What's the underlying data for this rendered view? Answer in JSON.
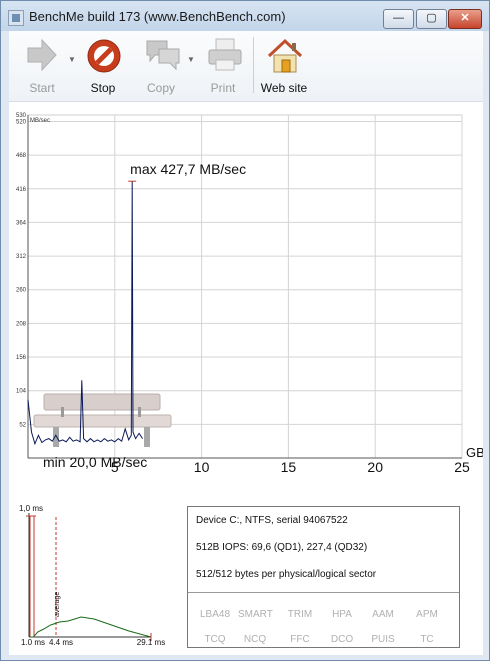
{
  "window": {
    "title": "BenchMe build 173 (www.BenchBench.com)"
  },
  "controls": {
    "minimize": "—",
    "maximize": "▢",
    "close": "✕"
  },
  "toolbar": {
    "buttons": [
      {
        "label": "Start",
        "icon": "arrow-right-icon",
        "enabled": false,
        "dropdown": true
      },
      {
        "label": "Stop",
        "icon": "stop-icon",
        "enabled": true,
        "dropdown": false
      },
      {
        "label": "Copy",
        "icon": "speech-bubbles-icon",
        "enabled": false,
        "dropdown": true
      },
      {
        "label": "Print",
        "icon": "printer-icon",
        "enabled": false,
        "dropdown": false
      },
      {
        "label": "Web site",
        "icon": "house-icon",
        "enabled": true,
        "dropdown": false
      }
    ]
  },
  "chart_data": [
    {
      "type": "line",
      "title": "",
      "ylabel": "MB/sec",
      "xlabel": "GB",
      "xlim": [
        0,
        25
      ],
      "ylim": [
        0,
        530
      ],
      "x_ticks": [
        5,
        10,
        15,
        20,
        25
      ],
      "y_ticks": [
        52,
        104,
        156,
        208,
        260,
        312,
        364,
        416,
        468,
        520
      ],
      "grid": true,
      "annotations": [
        "max 427,7 MB/sec",
        "min 20,0 MB/sec"
      ],
      "max": {
        "x": 6.0,
        "y": 427.7
      },
      "min": {
        "y": 20.0
      },
      "series": [
        {
          "color": "#0b1a5a",
          "x": [
            0.0,
            0.2,
            0.4,
            0.6,
            0.8,
            1.0,
            1.2,
            1.4,
            1.6,
            1.8,
            2.0,
            2.2,
            2.4,
            2.6,
            2.8,
            3.0,
            3.1,
            3.2,
            3.4,
            3.6,
            3.8,
            4.0,
            4.2,
            4.4,
            4.6,
            4.8,
            5.0,
            5.2,
            5.4,
            5.6,
            5.8,
            5.95,
            6.0,
            6.05,
            6.2,
            6.4,
            6.6
          ],
          "y": [
            90,
            40,
            22,
            35,
            24,
            28,
            30,
            26,
            35,
            26,
            28,
            25,
            32,
            26,
            28,
            25,
            120,
            30,
            25,
            30,
            25,
            28,
            25,
            30,
            26,
            28,
            25,
            30,
            26,
            45,
            28,
            35,
            427.7,
            40,
            30,
            38,
            30
          ]
        }
      ]
    },
    {
      "type": "line",
      "title": "",
      "x_labels": [
        "1,0 ms",
        "4,4 ms",
        "29,1 ms"
      ],
      "y_label_top": "1,0 ms",
      "average_label": "average",
      "x": [
        1.0,
        2.0,
        3.0,
        4.4,
        6.0,
        8.0,
        10.0,
        13.0,
        16.0,
        20.0,
        24.0,
        29.1
      ],
      "values": [
        0,
        0,
        5,
        8,
        12,
        15,
        16,
        20,
        18,
        12,
        6,
        0
      ]
    }
  ],
  "info": {
    "device": "Device C:, NTFS,  serial 94067522",
    "iops": "512B IOPS: 69,6 (QD1), 227,4 (QD32)",
    "sector": "512/512 bytes per physical/logical sector",
    "features_row1": [
      "LBA48",
      "SMART",
      "TRIM",
      "HPA",
      "AAM",
      "APM"
    ],
    "features_row2": [
      "TCQ",
      "NCQ",
      "FFC",
      "DCO",
      "PUIS",
      "TC"
    ]
  }
}
